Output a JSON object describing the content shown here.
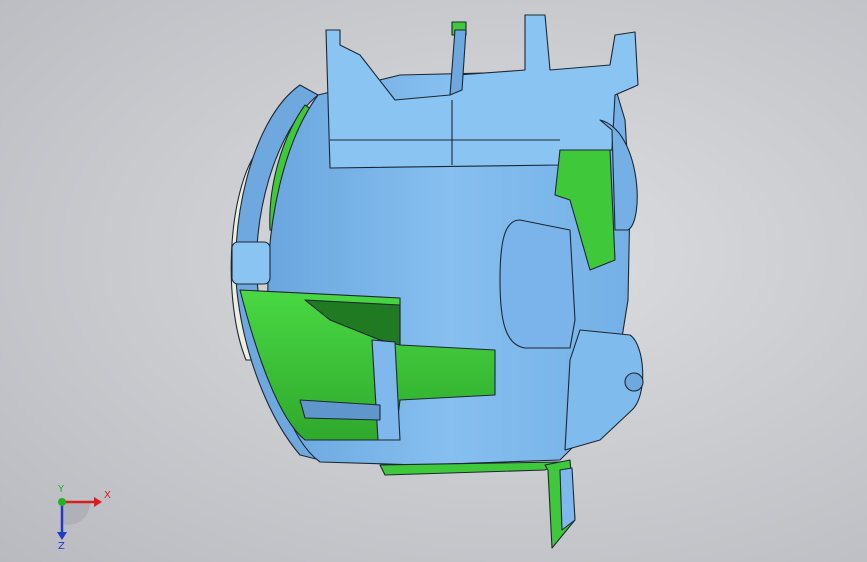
{
  "model": {
    "colors": {
      "body": "#7fb8ec",
      "body_dark": "#5f97cc",
      "body_light": "#a9d2f5",
      "green": "#3fc93a",
      "green_dark": "#1f7a22",
      "edge": "#1d2733",
      "lens": "#eeeedf"
    }
  },
  "triad": {
    "x_label": "X",
    "y_label": "Y",
    "z_label": "Z",
    "x_color": "#d81e1e",
    "y_color": "#22b322",
    "z_color": "#2238c8"
  }
}
